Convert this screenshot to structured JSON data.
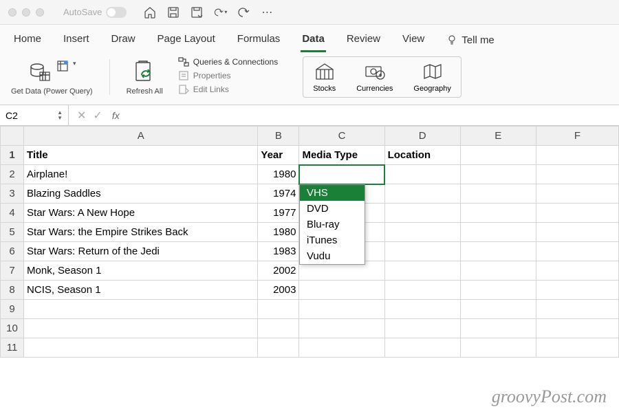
{
  "titlebar": {
    "autosave": "AutoSave"
  },
  "tabs": [
    "Home",
    "Insert",
    "Draw",
    "Page Layout",
    "Formulas",
    "Data",
    "Review",
    "View"
  ],
  "active_tab": "Data",
  "tellme": "Tell me",
  "ribbon": {
    "getdata": "Get Data (Power Query)",
    "refresh": "Refresh All",
    "qc": "Queries & Connections",
    "props": "Properties",
    "links": "Edit Links",
    "stocks": "Stocks",
    "currencies": "Currencies",
    "geography": "Geography"
  },
  "namebox": "C2",
  "fx": "fx",
  "columns": [
    "A",
    "B",
    "C",
    "D",
    "E",
    "F"
  ],
  "headers": {
    "A": "Title",
    "B": "Year",
    "C": "Media Type",
    "D": "Location"
  },
  "rows": [
    {
      "n": 1,
      "A": "Title",
      "B": "Year",
      "C": "Media Type",
      "D": "Location",
      "hdr": true
    },
    {
      "n": 2,
      "A": "Airplane!",
      "B": "1980",
      "sel": true
    },
    {
      "n": 3,
      "A": "Blazing Saddles",
      "B": "1974"
    },
    {
      "n": 4,
      "A": "Star Wars: A New Hope",
      "B": "1977"
    },
    {
      "n": 5,
      "A": "Star Wars: the Empire Strikes Back",
      "B": "1980"
    },
    {
      "n": 6,
      "A": "Star Wars: Return of the Jedi",
      "B": "1983"
    },
    {
      "n": 7,
      "A": "Monk, Season 1",
      "B": "2002"
    },
    {
      "n": 8,
      "A": "NCIS, Season 1",
      "B": "2003"
    },
    {
      "n": 9
    },
    {
      "n": 10
    },
    {
      "n": 11
    }
  ],
  "dropdown": {
    "options": [
      "VHS",
      "DVD",
      "Blu-ray",
      "iTunes",
      "Vudu"
    ],
    "selected": 0
  },
  "watermark": "groovyPost.com"
}
